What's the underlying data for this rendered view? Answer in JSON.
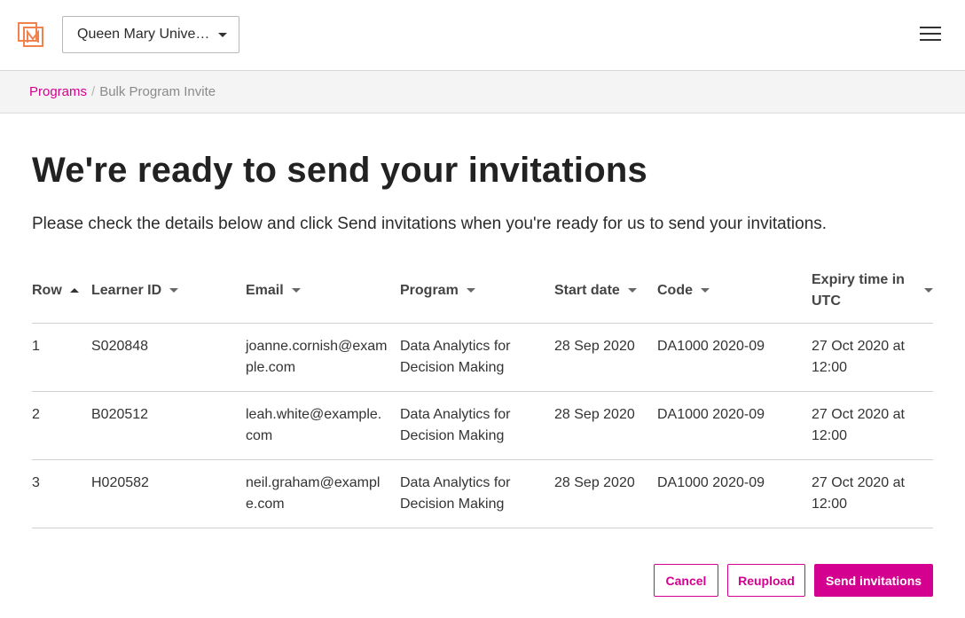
{
  "header": {
    "logo_icon": "orange-monogram-logo",
    "organization": "Queen Mary University of London",
    "menu_icon": "hamburger-menu-icon"
  },
  "breadcrumb": {
    "parent": "Programs",
    "separator": "/",
    "current": "Bulk Program Invite"
  },
  "main": {
    "title": "We're ready to send your invitations",
    "intro": "Please check the details below and click Send invitations when you're ready for us to send your invitations."
  },
  "table": {
    "columns": [
      {
        "key": "row",
        "label": "Row",
        "sort": "ascending"
      },
      {
        "key": "learner_id",
        "label": "Learner ID",
        "sort": "none"
      },
      {
        "key": "email",
        "label": "Email",
        "sort": "none"
      },
      {
        "key": "program",
        "label": "Program",
        "sort": "none"
      },
      {
        "key": "start_date",
        "label": "Start date",
        "sort": "none"
      },
      {
        "key": "code",
        "label": "Code",
        "sort": "none"
      },
      {
        "key": "expiry",
        "label": "Expiry time in UTC",
        "sort": "none"
      }
    ],
    "rows": [
      {
        "row": "1",
        "learner_id": "S020848",
        "email": "joanne.cornish@example.com",
        "program": "Data Analytics for Decision Making",
        "start_date": "28 Sep 2020",
        "code": "DA1000 2020-09",
        "expiry": "27 Oct 2020 at 12:00"
      },
      {
        "row": "2",
        "learner_id": "B020512",
        "email": "leah.white@example.com",
        "program": "Data Analytics for Decision Making",
        "start_date": "28 Sep 2020",
        "code": "DA1000 2020-09",
        "expiry": "27 Oct 2020 at 12:00"
      },
      {
        "row": "3",
        "learner_id": "H020582",
        "email": "neil.graham@example.com",
        "program": "Data Analytics for Decision Making",
        "start_date": "28 Sep 2020",
        "code": "DA1000 2020-09",
        "expiry": "27 Oct 2020 at 12:00"
      }
    ]
  },
  "actions": {
    "cancel": "Cancel",
    "reupload": "Reupload",
    "send": "Send invitations"
  },
  "colors": {
    "accent": "#d4008f",
    "logo": "#f0824f"
  }
}
